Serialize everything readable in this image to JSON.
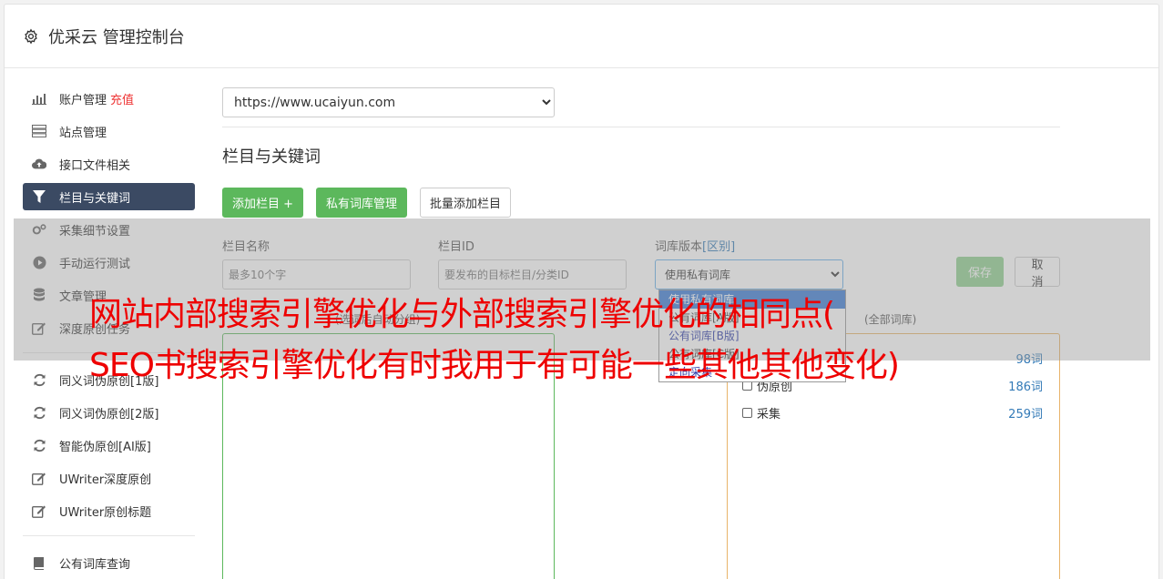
{
  "header": {
    "title": "优采云 管理控制台"
  },
  "sidebar": {
    "items": [
      {
        "label": "账户管理",
        "badge": "充值",
        "icon": "bar-chart-icon"
      },
      {
        "label": "站点管理",
        "icon": "server-icon"
      },
      {
        "label": "接口文件相关",
        "icon": "cloud-upload-icon"
      },
      {
        "label": "栏目与关键词",
        "icon": "filter-icon",
        "active": true
      },
      {
        "label": "采集细节设置",
        "icon": "cogs-icon"
      },
      {
        "label": "手动运行测试",
        "icon": "play-circle-icon"
      },
      {
        "label": "文章管理",
        "icon": "database-icon"
      },
      {
        "label": "深度原创任务",
        "icon": "edit-icon"
      },
      {
        "label": "同义词伪原创[1版]",
        "icon": "refresh-icon"
      },
      {
        "label": "同义词伪原创[2版]",
        "icon": "refresh-icon"
      },
      {
        "label": "智能伪原创[AI版]",
        "icon": "refresh-icon"
      },
      {
        "label": "UWriter深度原创",
        "icon": "edit-icon"
      },
      {
        "label": "UWriter原创标题",
        "icon": "edit-icon"
      },
      {
        "label": "公有词库查询",
        "icon": "book-icon"
      }
    ]
  },
  "main": {
    "site_select": "https://www.ucaiyun.com",
    "section_title": "栏目与关键词",
    "buttons": {
      "add": "添加栏目 +",
      "private_lib": "私有词库管理",
      "batch_add": "批量添加栏目"
    },
    "form": {
      "name_label": "栏目名称",
      "name_placeholder": "最多10个字",
      "id_label": "栏目ID",
      "id_placeholder": "要发布的目标栏目/分类ID",
      "version_label": "词库版本",
      "version_link": "[区别]",
      "version_value": "使用私有词库",
      "save": "保存",
      "cancel": "取消"
    },
    "dropdown": [
      "使用私有词库",
      "公有词库[A版]",
      "公有词库[B版]",
      "公有词库[C版]",
      "定向采集"
    ],
    "hint_left": "(选词后自动分组)",
    "hint_right": "(全部词库)",
    "libs": [
      {
        "label": "",
        "count": "98词"
      },
      {
        "label": "伪原创",
        "count": "186词"
      },
      {
        "label": "采集",
        "count": "259词"
      }
    ]
  },
  "watermark": {
    "line1": "网站内部搜索引擎优化与外部搜索引擎优化的相同点(",
    "line2": "SEO书搜索引擎优化有时我用于有可能一些其他其他变化)"
  }
}
